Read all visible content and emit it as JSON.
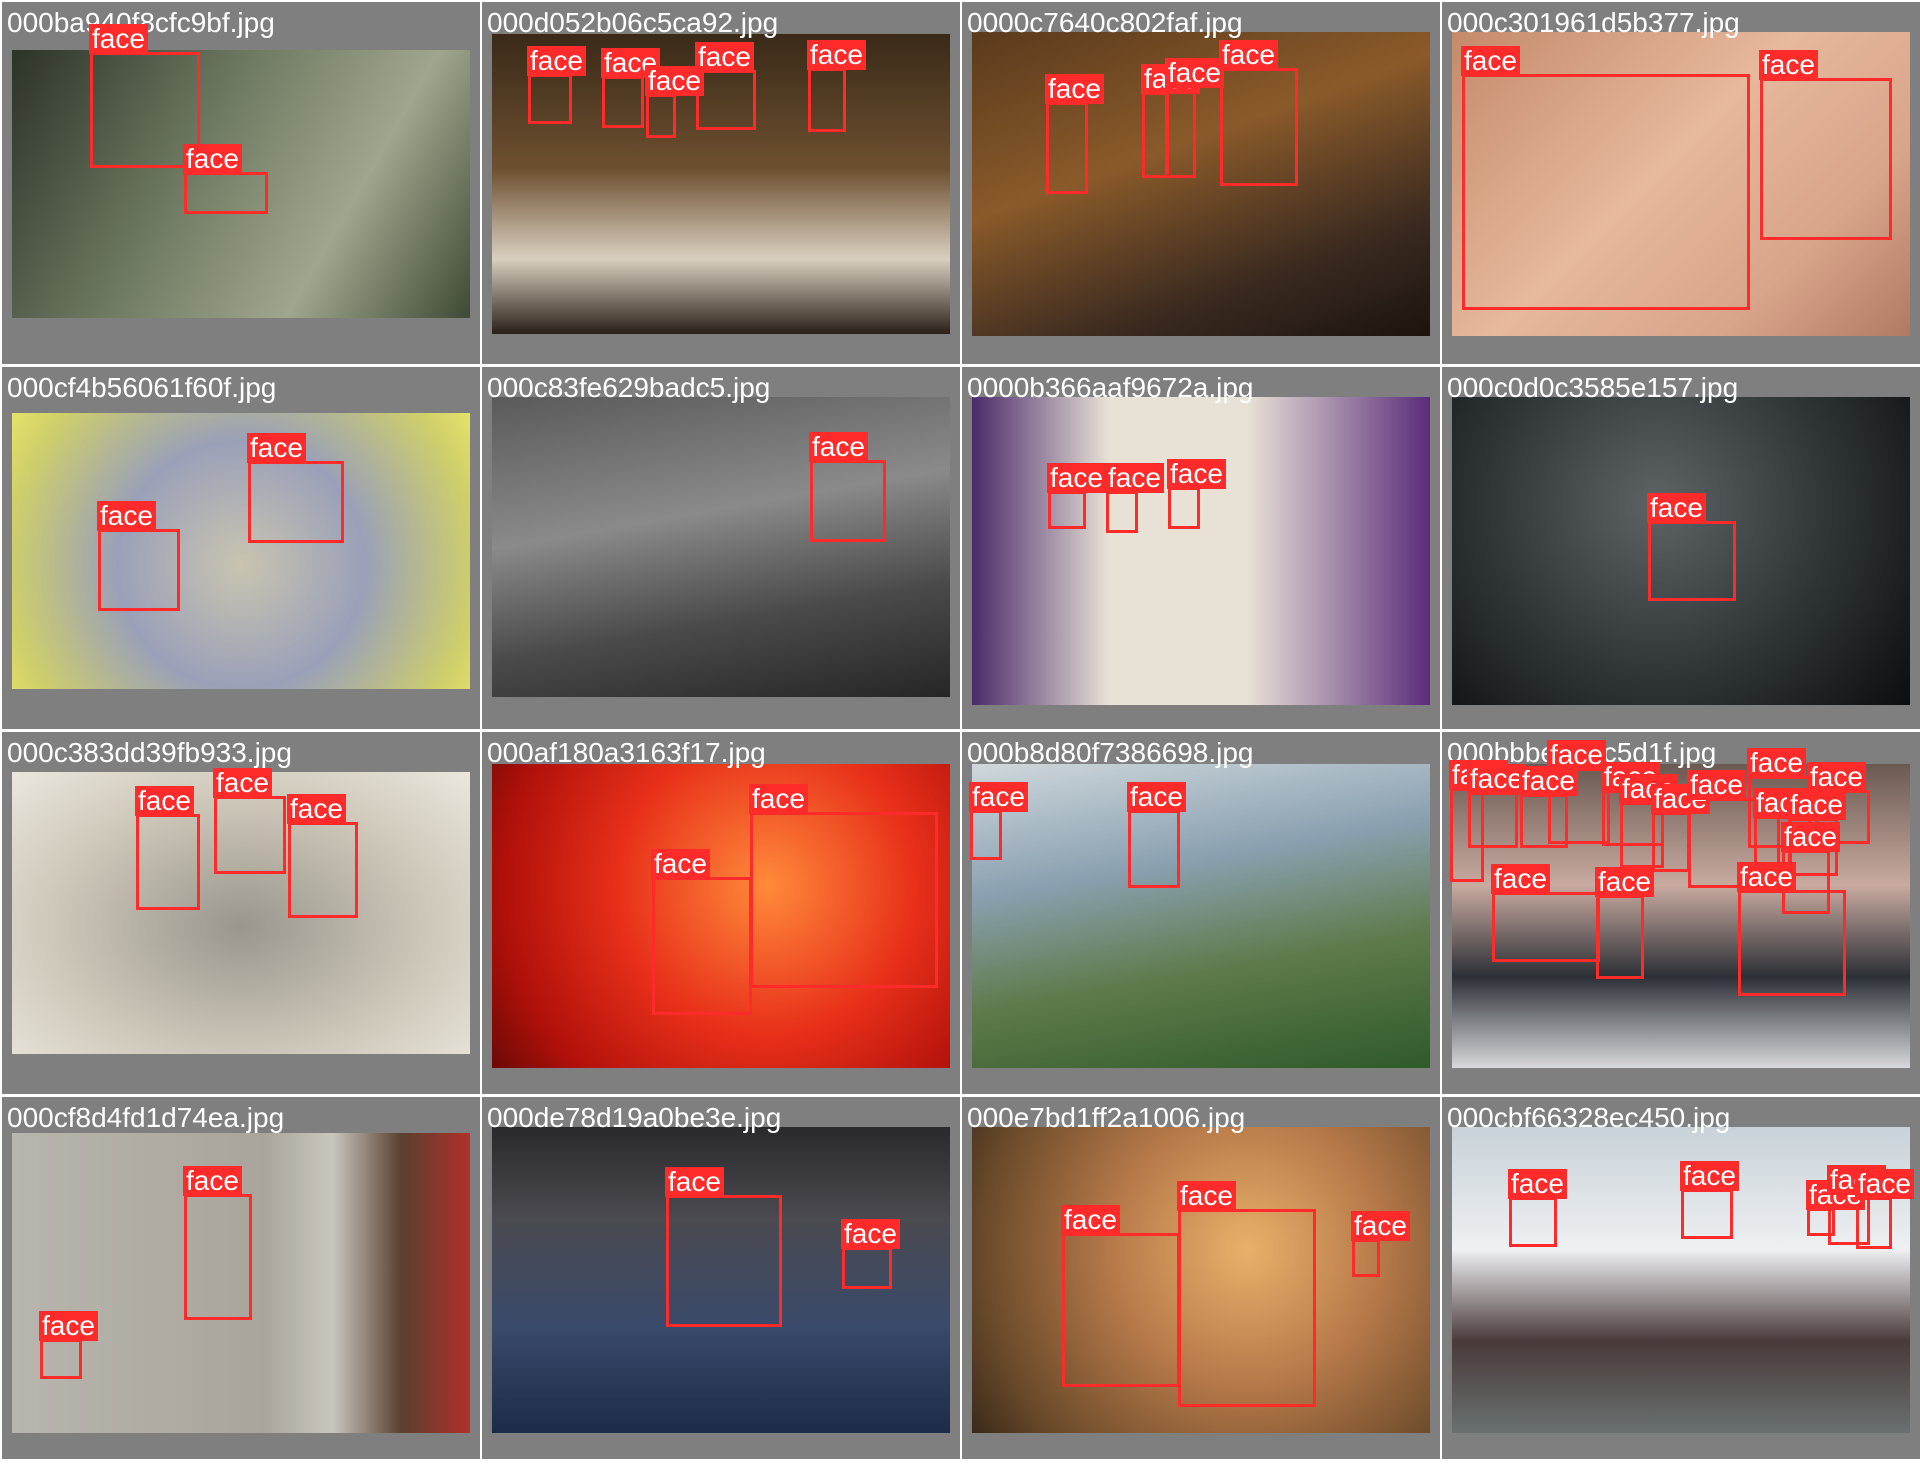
{
  "label_text": "face",
  "colors": {
    "box": "#ff2a2a",
    "tile_bg": "#7f7f7f",
    "filename": "#ffffff"
  },
  "tiles": [
    {
      "filename": "000ba940f8cfc9bf.jpg",
      "faces": 2
    },
    {
      "filename": "000d052b06c5ca92.jpg",
      "faces": 5
    },
    {
      "filename": "0000c7640c802faf.jpg",
      "faces": 4
    },
    {
      "filename": "000c301961d5b377.jpg",
      "faces": 2
    },
    {
      "filename": "000cf4b56061f60f.jpg",
      "faces": 2
    },
    {
      "filename": "000c83fe629badc5.jpg",
      "faces": 1
    },
    {
      "filename": "0000b366aaf9672a.jpg",
      "faces": 3
    },
    {
      "filename": "000c0d0c3585e157.jpg",
      "faces": 1
    },
    {
      "filename": "000c383dd39fb933.jpg",
      "faces": 3
    },
    {
      "filename": "000af180a3163f17.jpg",
      "faces": 2
    },
    {
      "filename": "000b8d80f7386698.jpg",
      "faces": 2
    },
    {
      "filename": "000bbbe941c5d1f.jpg",
      "faces": 16
    },
    {
      "filename": "000cf8d4fd1d74ea.jpg",
      "faces": 2
    },
    {
      "filename": "000de78d19a0be3e.jpg",
      "faces": 2
    },
    {
      "filename": "000e7bd1ff2a1006.jpg",
      "faces": 3
    },
    {
      "filename": "000cbf66328ec450.jpg",
      "faces": 5
    }
  ]
}
